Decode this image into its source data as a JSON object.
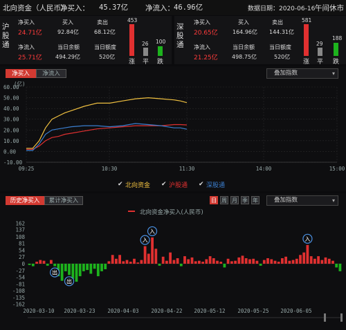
{
  "header": {
    "title": "北向资金（人民币）",
    "net_buy_label": "净买入：",
    "net_buy_value": "45.37亿",
    "net_flow_label": "净流入：",
    "net_flow_value": "46.96亿",
    "date_label": "数据日期：2020-06-16",
    "status": "午间休市"
  },
  "shanghai": {
    "name": "沪股通",
    "net_buy_label": "净买入",
    "net_buy_value": "24.71亿",
    "net_flow_label": "净流入",
    "net_flow_value": "25.71亿",
    "buy_label": "买入",
    "buy_value": "92.84亿",
    "sell_label": "卖出",
    "sell_value": "68.12亿",
    "balance_label": "当日余额",
    "balance_value": "494.29亿",
    "quota_label": "当日额度",
    "quota_value": "520亿",
    "up_count": "453",
    "flat_count": "26",
    "down_count": "100",
    "up_label": "涨",
    "flat_label": "平",
    "down_label": "跌"
  },
  "shenzhen": {
    "name": "深股通",
    "net_buy_label": "净买入",
    "net_buy_value": "20.65亿",
    "net_flow_label": "净流入",
    "net_flow_value": "21.25亿",
    "buy_label": "买入",
    "buy_value": "164.96亿",
    "sell_label": "卖出",
    "sell_value": "144.31亿",
    "balance_label": "当日余额",
    "balance_value": "498.75亿",
    "quota_label": "当日额度",
    "quota_value": "520亿",
    "up_count": "581",
    "flat_count": "29",
    "down_count": "188",
    "up_label": "涨",
    "flat_label": "平",
    "down_label": "跌"
  },
  "intraday": {
    "tab_active": "净买入",
    "tab_inactive": "净流入",
    "overlay_label": "叠加指数",
    "unit": "(亿)",
    "legend": [
      "北向资金",
      "沪股通",
      "深股通"
    ]
  },
  "history": {
    "tab_active": "历史净买入",
    "tab_inactive": "累计净买入",
    "periods": [
      "日",
      "周",
      "月",
      "季",
      "年"
    ],
    "overlay_label": "叠加指数",
    "title": "北向资金净买入(人民币)",
    "in_label": "入",
    "out_label": "出"
  },
  "colors": {
    "north": "#f0c040",
    "sh": "#e03030",
    "sz": "#3b7fd0",
    "up": "#e03030",
    "down": "#1db31d"
  },
  "chart_data": [
    {
      "type": "line",
      "ylabel": "(亿)",
      "ylim": [
        -10,
        60
      ],
      "yticks": [
        "60.00",
        "50.00",
        "40.00",
        "30.00",
        "20.00",
        "10.00",
        "0.00",
        "-10.00"
      ],
      "xticks": [
        "09:25",
        "10:30",
        "11:30",
        "14:00",
        "15:00"
      ],
      "x": [
        "09:25",
        "09:30",
        "09:35",
        "09:40",
        "09:45",
        "09:50",
        "09:55",
        "10:00",
        "10:10",
        "10:20",
        "10:30",
        "10:40",
        "10:50",
        "11:00",
        "11:10",
        "11:20",
        "11:25",
        "11:30"
      ],
      "series": [
        {
          "name": "北向资金",
          "values": [
            3,
            3,
            10,
            22,
            30,
            33,
            36,
            38,
            42,
            45,
            45,
            47,
            49,
            50,
            49,
            48,
            47,
            45.4
          ]
        },
        {
          "name": "沪股通",
          "values": [
            2,
            2,
            5,
            10,
            13,
            14,
            16,
            17,
            19,
            21,
            22,
            23,
            24,
            24,
            24,
            25,
            25,
            24.7
          ]
        },
        {
          "name": "深股通",
          "values": [
            1,
            1,
            7,
            16,
            20,
            21,
            22,
            23,
            24,
            24,
            23,
            24,
            26,
            25,
            24,
            22,
            22,
            20.7
          ]
        }
      ]
    },
    {
      "type": "bar",
      "title": "北向资金净买入(人民币)",
      "ylim": [
        -160,
        160
      ],
      "yticks": [
        "162",
        "137",
        "108",
        "81",
        "54",
        "27",
        "0",
        "-27",
        "-54",
        "-81",
        "-108",
        "-135",
        "-162"
      ],
      "xticks": [
        "2020-03-10",
        "2020-03-23",
        "2020-04-03",
        "2020-04-22",
        "2020-05-12",
        "2020-05-25",
        "2020-06-05"
      ],
      "values": [
        -5,
        -10,
        8,
        15,
        12,
        -8,
        15,
        -10,
        -50,
        -68,
        -30,
        -45,
        -60,
        -72,
        -50,
        -30,
        -25,
        -40,
        -20,
        -50,
        -30,
        -22,
        10,
        35,
        20,
        35,
        10,
        15,
        8,
        20,
        5,
        15,
        70,
        40,
        105,
        60,
        -8,
        28,
        12,
        45,
        15,
        22,
        -10,
        30,
        18,
        25,
        10,
        12,
        8,
        18,
        30,
        22,
        12,
        8,
        -15,
        20,
        10,
        12,
        25,
        32,
        22,
        18,
        20,
        12,
        -8,
        15,
        22,
        18,
        12,
        8,
        22,
        28,
        12,
        15,
        20,
        35,
        45,
        75,
        30,
        20,
        30,
        15,
        25,
        20,
        12,
        -15,
        -30
      ]
    }
  ]
}
